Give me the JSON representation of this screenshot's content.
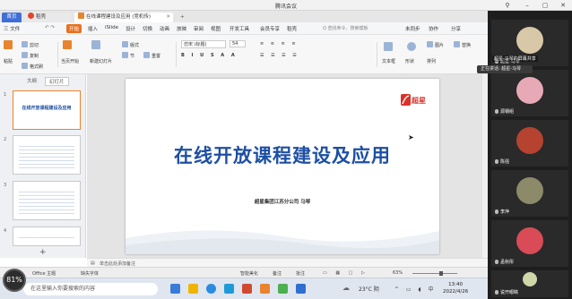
{
  "meeting": {
    "title": "腾讯会议"
  },
  "wps": {
    "tabs": {
      "home": "首页",
      "daoke": "稻壳",
      "doc": "在线课程建设及应用 (竞机传)"
    },
    "menu": {
      "file": "三 文件",
      "start": "开始",
      "insert": "插入",
      "design": "设计",
      "switch": "切换",
      "animation": "动画",
      "slideshow": "放映",
      "review": "审阅",
      "view": "视图",
      "devtools": "开发工具",
      "member": "会员专享",
      "daoke": "稻壳",
      "search": "Q 查找命令、搜索模板",
      "unsync": "未同步",
      "collab": "协作",
      "share": "分享",
      "islide": "iSlide"
    },
    "toolbar": {
      "paste": "粘贴",
      "cut": "剪切",
      "copy": "复制",
      "format_painter": "格式刷",
      "from_current": "当页开始",
      "new_slide": "新建幻灯片",
      "layout": "版式",
      "section": "节",
      "reset": "重置",
      "font": "仿宋 (标题)",
      "font_size": "54",
      "arrange": "排列",
      "textbox": "文本框",
      "shapes": "形状",
      "image": "图片",
      "replace": "替换"
    },
    "left_panel": {
      "tab_outline": "大纲",
      "tab_slides": "幻灯片",
      "thumbs": [
        {
          "num": "1",
          "title": "在线开放课程建设及应用"
        },
        {
          "num": "2"
        },
        {
          "num": "3"
        },
        {
          "num": "4"
        }
      ],
      "add": "+"
    },
    "slide": {
      "logo_text": "超星",
      "title": "在线开放课程建设及应用",
      "subtitle": "超星集团江苏分公司    马琴"
    },
    "notes": "单击此处添加备注",
    "status": {
      "theme": "Office 主题",
      "missing_font": "缺失字体",
      "smart_beauty": "智能美化",
      "notes_btn": "备注",
      "comments": "批注",
      "zoom": "63%",
      "zoom_level": 0.63
    }
  },
  "taskbar": {
    "search_placeholder": "在这里输入你要搜索的内容",
    "weather": "23°C 阴",
    "time": "13:40",
    "date": "2022/4/26",
    "cpu": "81%"
  },
  "participants": {
    "speaking": "正在讲话: 超星-马琴",
    "host_label": "超星-马琴的屏幕共享",
    "list": [
      {
        "name": "超星-马琴"
      },
      {
        "name": "源钢组"
      },
      {
        "name": "陈强"
      },
      {
        "name": "李萍"
      },
      {
        "name": "孟秋彤"
      },
      {
        "name": "说开眼睛"
      }
    ]
  },
  "colors": {
    "accent_blue": "#1d4fa3",
    "wps_orange": "#e8711f",
    "panel_dark": "#1e1e1e"
  }
}
